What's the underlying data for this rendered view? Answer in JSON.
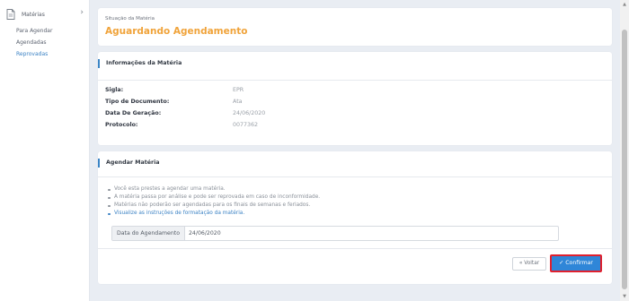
{
  "sidebar": {
    "section_label": "Matérias",
    "items": [
      {
        "label": "Para Agendar"
      },
      {
        "label": "Agendadas"
      },
      {
        "label": "Reprovadas"
      }
    ],
    "active_item": "Reprovadas"
  },
  "status": {
    "label": "Situação da Matéria",
    "value": "Aguardando Agendamento"
  },
  "info": {
    "title": "Informações da Matéria",
    "fields": [
      {
        "label": "Sigla:",
        "value": "EPR"
      },
      {
        "label": "Tipo de Documento:",
        "value": "Ata"
      },
      {
        "label": "Data De Geração:",
        "value": "24/06/2020"
      },
      {
        "label": "Protocolo:",
        "value": "0077362"
      }
    ]
  },
  "agendar": {
    "title": "Agendar Matéria",
    "notes": [
      "Você esta prestes a agendar uma matéria.",
      "A matéria passa por análise e pode ser reprovada em caso de inconformidade.",
      "Matérias não poderão ser agendadas para os finais de semanas e feriados."
    ],
    "link_text": "Visualize as instruções de formatação da matéria.",
    "date_label": "Data do Agendamento",
    "date_value": "24/06/2020",
    "voltar_label": "« Voltar",
    "confirmar_label": "✓ Confirmar"
  },
  "colors": {
    "accent": "#3d86c6",
    "status": "#f0a33a",
    "primary_button": "#2f86d8",
    "highlight_border": "#e0202e"
  },
  "icons": {
    "sidebar_section": "document-icon",
    "expand": "chevron-right-icon"
  }
}
